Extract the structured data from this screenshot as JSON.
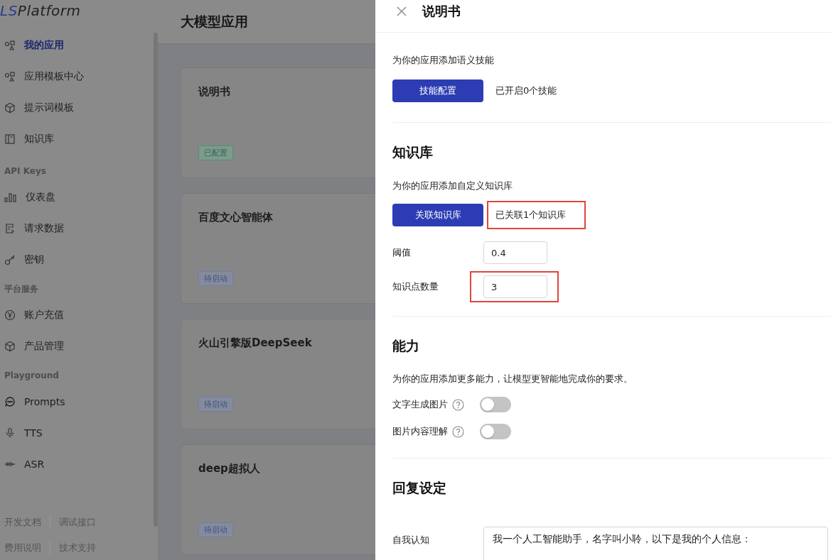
{
  "sidebar": {
    "logo": {
      "accent": "LS",
      "name": "Platform"
    },
    "groups": [
      {
        "items": [
          {
            "label": "我的应用",
            "selected": true
          },
          {
            "label": "应用模板中心",
            "selected": false
          },
          {
            "label": "提示词模板",
            "selected": false
          },
          {
            "label": "知识库",
            "selected": false
          }
        ]
      },
      {
        "heading": "API Keys",
        "items": [
          {
            "label": "仪表盘",
            "selected": false
          },
          {
            "label": "请求数据",
            "selected": false
          },
          {
            "label": "密钥",
            "selected": false
          }
        ]
      },
      {
        "heading": "平台服务",
        "items": [
          {
            "label": "账户充值",
            "selected": false
          },
          {
            "label": "产品管理",
            "selected": false
          }
        ]
      },
      {
        "heading": "Playground",
        "items": [
          {
            "label": "Prompts",
            "selected": false
          },
          {
            "label": "TTS",
            "selected": false
          },
          {
            "label": "ASR",
            "selected": false
          }
        ]
      }
    ],
    "footer_links": [
      "开发文档",
      "调试接口",
      "费用说明",
      "技术支持"
    ]
  },
  "main": {
    "title": "大模型应用",
    "apps": [
      {
        "name": "说明书",
        "status": "已配置",
        "kind": "configured"
      },
      {
        "name": "百度文心智能体",
        "status": "待启动",
        "kind": "pending"
      },
      {
        "name": "火山引擎版DeepSeek",
        "status": "待启动",
        "kind": "pending"
      },
      {
        "name": "deep超拟人",
        "status": "待启动",
        "kind": "pending"
      }
    ]
  },
  "drawer": {
    "title": "说明书",
    "skills": {
      "description": "为你的应用添加语义技能",
      "button": "技能配置",
      "status": "已开启0个技能"
    },
    "knowledge": {
      "heading": "知识库",
      "description": "为你的应用添加自定义知识库",
      "button": "关联知识库",
      "status": "已关联1个知识库",
      "status_highlighted": true,
      "fields": [
        {
          "label": "阈值",
          "value": "0.4",
          "highlighted": false
        },
        {
          "label": "知识点数量",
          "value": "3",
          "highlighted": true
        }
      ]
    },
    "abilities": {
      "heading": "能力",
      "description": "为你的应用添加更多能力，让模型更智能地完成你的要求。",
      "toggles": [
        {
          "label": "文字生成图片",
          "on": false
        },
        {
          "label": "图片内容理解",
          "on": false
        }
      ]
    },
    "reply": {
      "heading": "回复设定",
      "fields": [
        {
          "label": "自我认知",
          "value": "我一个人工智能助手，名字叫小聆，以下是我的个人信息："
        }
      ]
    }
  }
}
